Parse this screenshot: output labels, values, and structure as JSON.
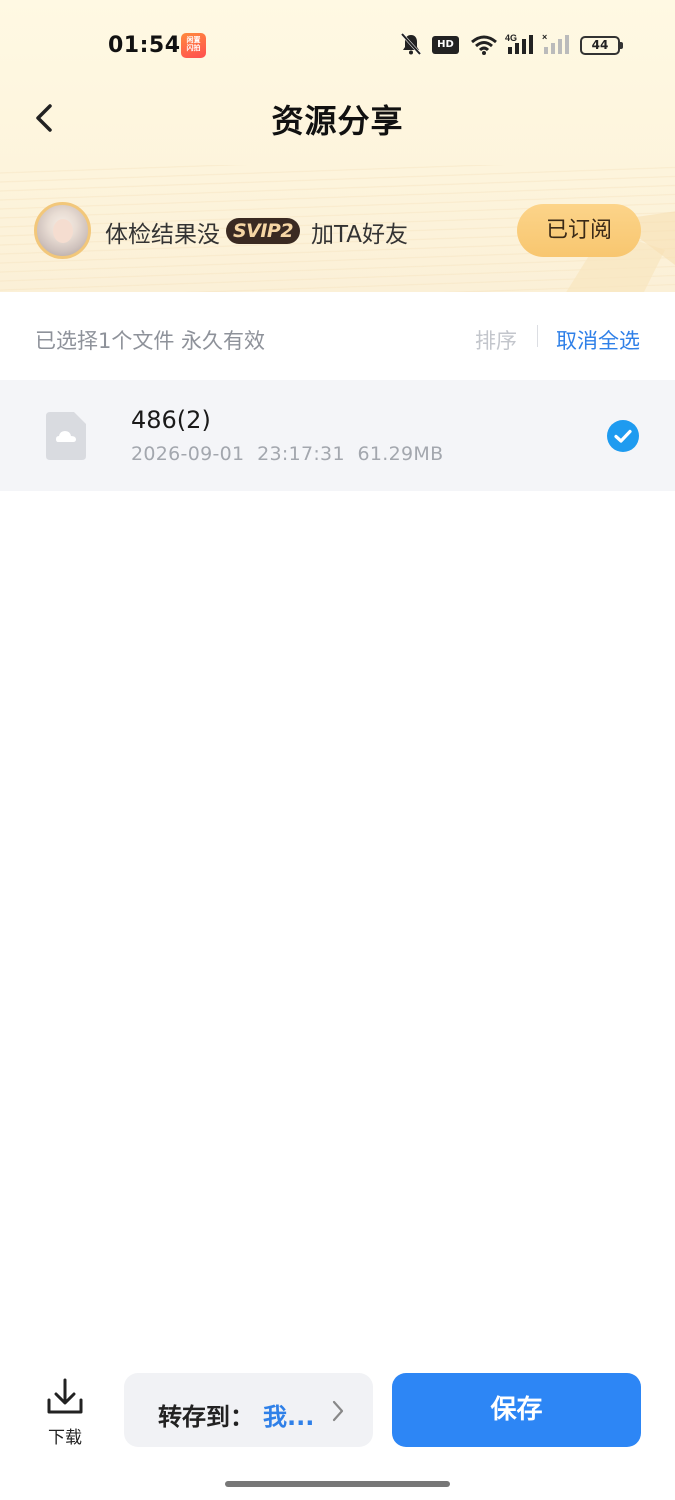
{
  "status_bar": {
    "time": "01:54",
    "app_badge_text": "闲置闪拍",
    "hd_label": "HD",
    "battery": "44",
    "network": "4G"
  },
  "header": {
    "title": "资源分享"
  },
  "sharer": {
    "name": "体检结果没",
    "vip_badge": "SVIP2",
    "add_friend": "加TA好友",
    "subscribe_label": "已订阅"
  },
  "toolbar": {
    "selected_info": "已选择1个文件 永久有效",
    "sort_label": "排序",
    "cancel_all_label": "取消全选"
  },
  "files": [
    {
      "name": "486(2)",
      "meta": "2026-09-01  23:17:31  61.29MB",
      "selected": true
    }
  ],
  "bottom_bar": {
    "download_label": "下载",
    "save_to_label": "转存到：",
    "save_to_target": "我...",
    "save_label": "保存"
  },
  "colors": {
    "accent_blue": "#2d86f5",
    "link_blue": "#2f80e8",
    "gold": "#f8c66f",
    "header_bg": "#fdf4dc"
  }
}
